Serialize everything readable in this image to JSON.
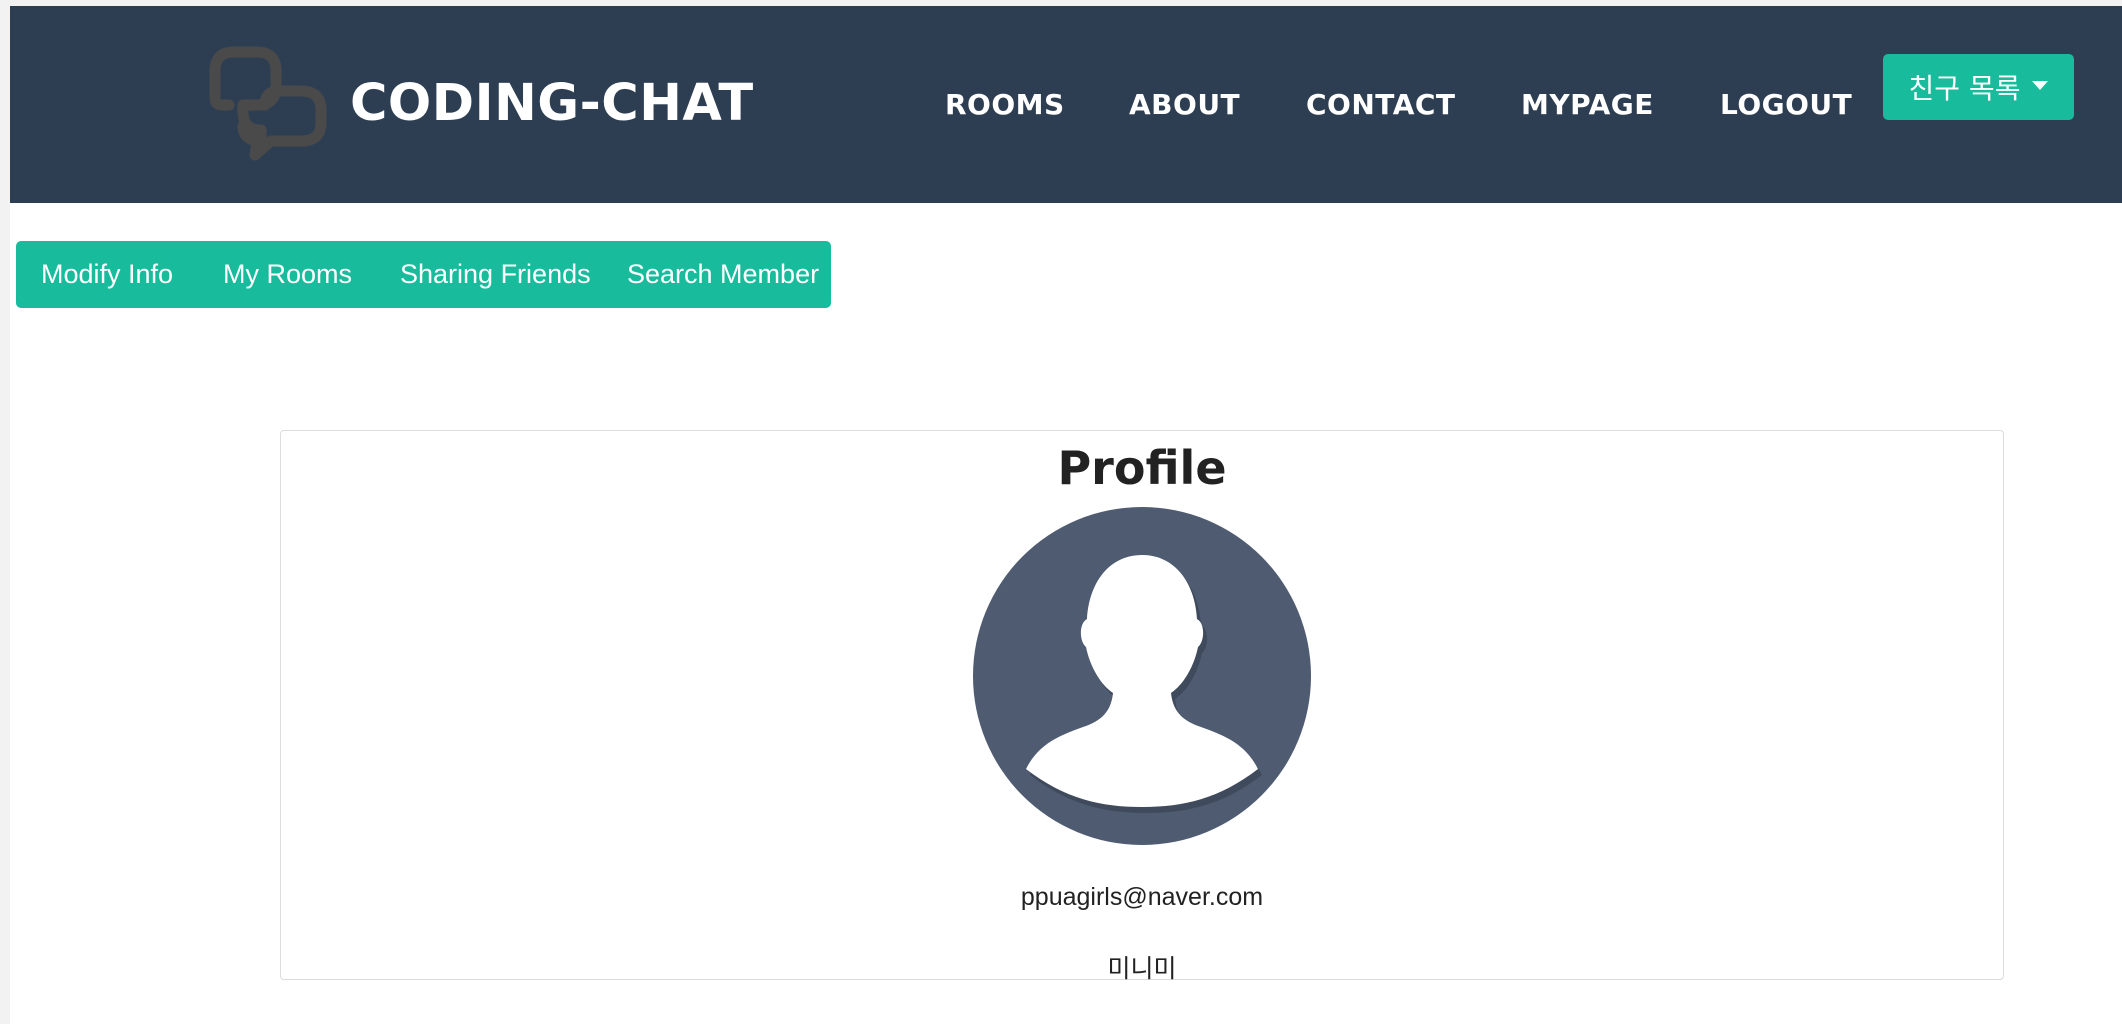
{
  "navbar": {
    "brand": "CODING-CHAT",
    "logo_icon": "chat-bubbles-icon",
    "links": [
      "ROOMS",
      "ABOUT",
      "CONTACT",
      "MYPAGE",
      "LOGOUT"
    ],
    "friends_dropdown": "친구 목록",
    "background_color": "#2e3e52",
    "accent_color": "#18bc9c"
  },
  "subnav": {
    "items": [
      "Modify Info",
      "My Rooms",
      "Sharing Friends",
      "Search Member"
    ]
  },
  "profile": {
    "title": "Profile",
    "avatar_icon": "default-user-avatar-icon",
    "email": "ppuagirls@naver.com",
    "nickname": "미니미"
  }
}
